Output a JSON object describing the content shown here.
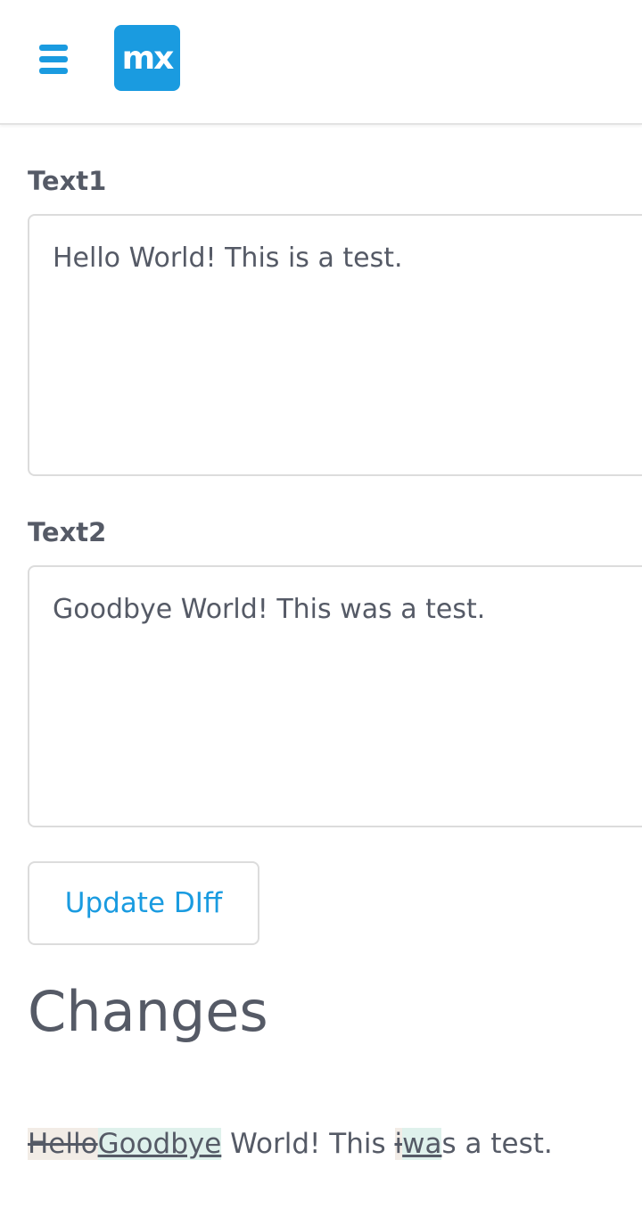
{
  "header": {
    "menu_icon": "hamburger-menu-icon",
    "logo_text": "mx",
    "accent_color": "#1a9be0"
  },
  "form": {
    "text1_label": "Text1",
    "text1_value": "Hello World! This is a test.",
    "text2_label": "Text2",
    "text2_value": "Goodbye World! This was a test.",
    "update_button_label": "Update DIff"
  },
  "changes": {
    "heading": "Changes",
    "segments": [
      {
        "type": "deleted",
        "text": "Hello"
      },
      {
        "type": "inserted",
        "text": "Goodbye"
      },
      {
        "type": "equal",
        "text": " World! This "
      },
      {
        "type": "deleted",
        "text": "i"
      },
      {
        "type": "inserted",
        "text": "wa"
      },
      {
        "type": "equal",
        "text": "s a test."
      }
    ],
    "deleted_bg": "#f2ece6",
    "inserted_bg": "#dff1ec"
  }
}
